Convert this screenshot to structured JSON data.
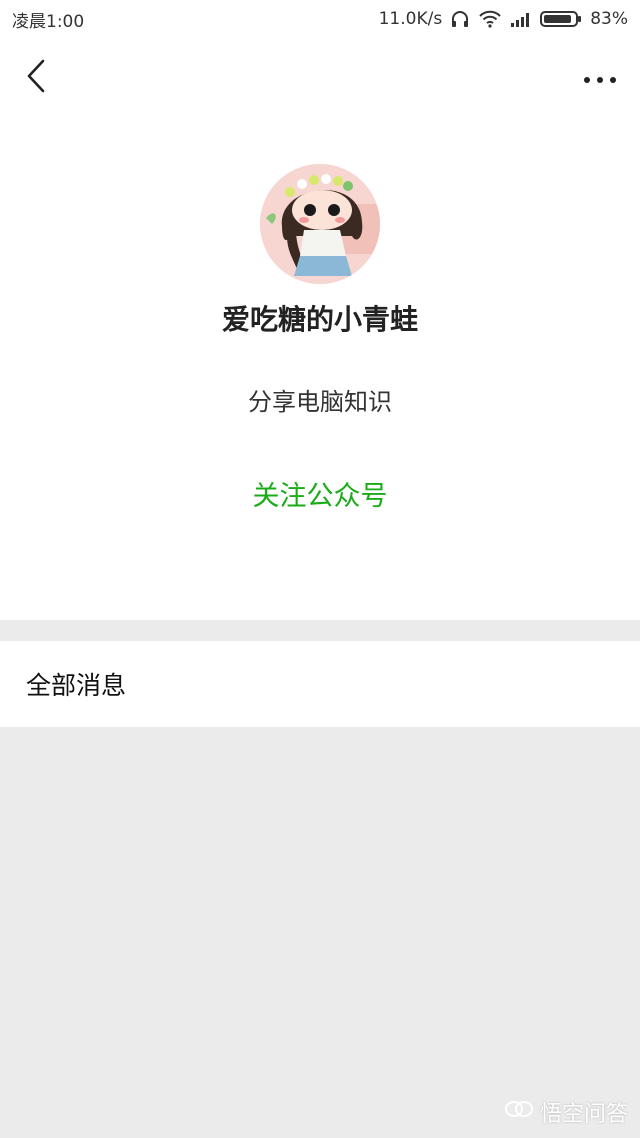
{
  "status_bar": {
    "time": "凌晨1:00",
    "network_speed": "11.0K/s",
    "battery_percent": "83%",
    "icons": [
      "headphones-icon",
      "wifi-icon",
      "signal-icon",
      "battery-icon"
    ]
  },
  "nav": {
    "back_icon": "chevron-left-icon",
    "more_icon": "more-dots-icon"
  },
  "profile": {
    "name": "爱吃糖的小青蛙",
    "description": "分享电脑知识",
    "follow_label": "关注公众号"
  },
  "section": {
    "all_messages_label": "全部消息"
  },
  "watermark": {
    "text": "悟空问答"
  },
  "colors": {
    "accent_green": "#1aad19",
    "background": "#ebebeb",
    "card": "#ffffff"
  }
}
